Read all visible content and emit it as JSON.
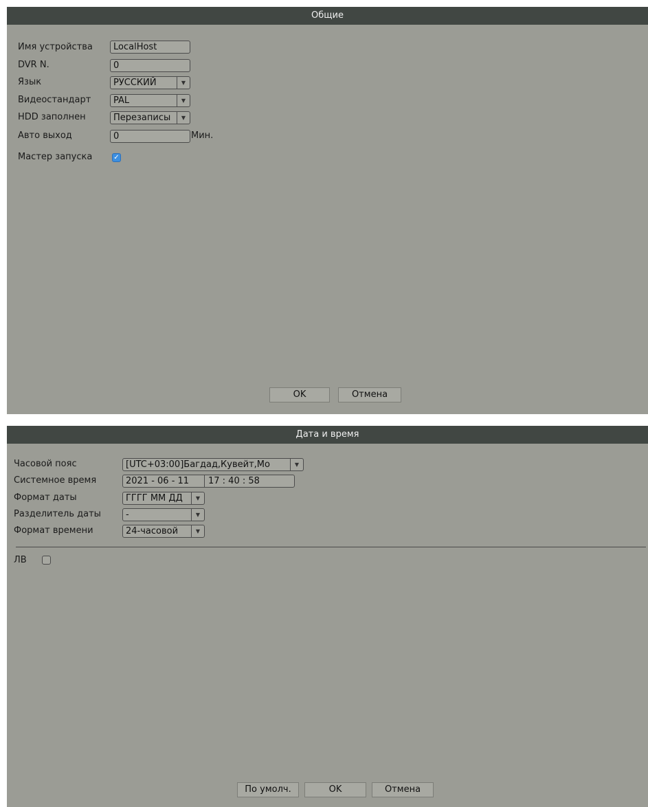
{
  "general": {
    "title": "Общие",
    "device_name_label": "Имя устройства",
    "device_name_value": "LocalHost",
    "dvr_no_label": "DVR N.",
    "dvr_no_value": "0",
    "language_label": "Язык",
    "language_value": "РУССКИЙ",
    "video_standard_label": "Видеостандарт",
    "video_standard_value": "PAL",
    "hdd_full_label": "HDD заполнен",
    "hdd_full_value": "Перезаписы",
    "auto_logout_label": "Авто выход",
    "auto_logout_value": "0",
    "auto_logout_unit": "Мин.",
    "startup_wizard_label": "Мастер запуска",
    "startup_wizard_checked": true,
    "ok_label": "OK",
    "cancel_label": "Отмена"
  },
  "datetime": {
    "title": "Дата и время",
    "timezone_label": "Часовой пояс",
    "timezone_value": "[UTC+03:00]Багдад,Кувейт,Мо",
    "system_time_label": "Системное время",
    "system_date_value": "2021 - 06 - 11",
    "system_time_value": "17 : 40 : 58",
    "date_format_label": "Формат даты",
    "date_format_value": "ГГГГ ММ ДД",
    "date_separator_label": "Разделитель даты",
    "date_separator_value": "-",
    "time_format_label": "Формат времени",
    "time_format_value": "24-часовой",
    "dst_label": "ЛВ",
    "dst_checked": false,
    "default_label": "По умолч.",
    "ok_label": "OK",
    "cancel_label": "Отмена"
  },
  "icons": {
    "dropdown_arrow": "▼",
    "checkmark": "✓"
  }
}
